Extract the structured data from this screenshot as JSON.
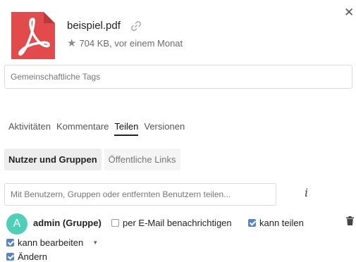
{
  "file": {
    "name": "beispiel.pdf",
    "meta": "704 KB, vor einem Monat"
  },
  "tags": {
    "placeholder": "Gemeinschaftliche Tags"
  },
  "tabs": [
    {
      "label": "Aktivitäten",
      "active": false
    },
    {
      "label": "Kommentare",
      "active": false
    },
    {
      "label": "Teilen",
      "active": true
    },
    {
      "label": "Versionen",
      "active": false
    }
  ],
  "subtabs": [
    {
      "label": "Nutzer und Gruppen",
      "active": true
    },
    {
      "label": "Öffentliche Links",
      "active": false
    }
  ],
  "share": {
    "placeholder": "Mit Benutzern, Gruppen oder entfernten Benutzern teilen...",
    "info_label": "i"
  },
  "sharee": {
    "avatar_letter": "A",
    "name": "admin (Gruppe)",
    "email_notify_label": "per E-Mail benachrichtigen",
    "email_notify_checked": false,
    "can_share_label": "kann teilen",
    "can_share_checked": true,
    "can_edit_label": "kann bearbeiten",
    "can_edit_checked": true,
    "change_label": "Ändern",
    "change_checked": true
  },
  "colors": {
    "pdf_red": "#e14b4b",
    "avatar": "#4fcfb5",
    "checkbox": "#5a84c5"
  },
  "icons": [
    "close-icon",
    "pdf-file-icon",
    "link-icon",
    "star-icon",
    "info-icon",
    "chevron-down-icon",
    "trash-icon"
  ]
}
